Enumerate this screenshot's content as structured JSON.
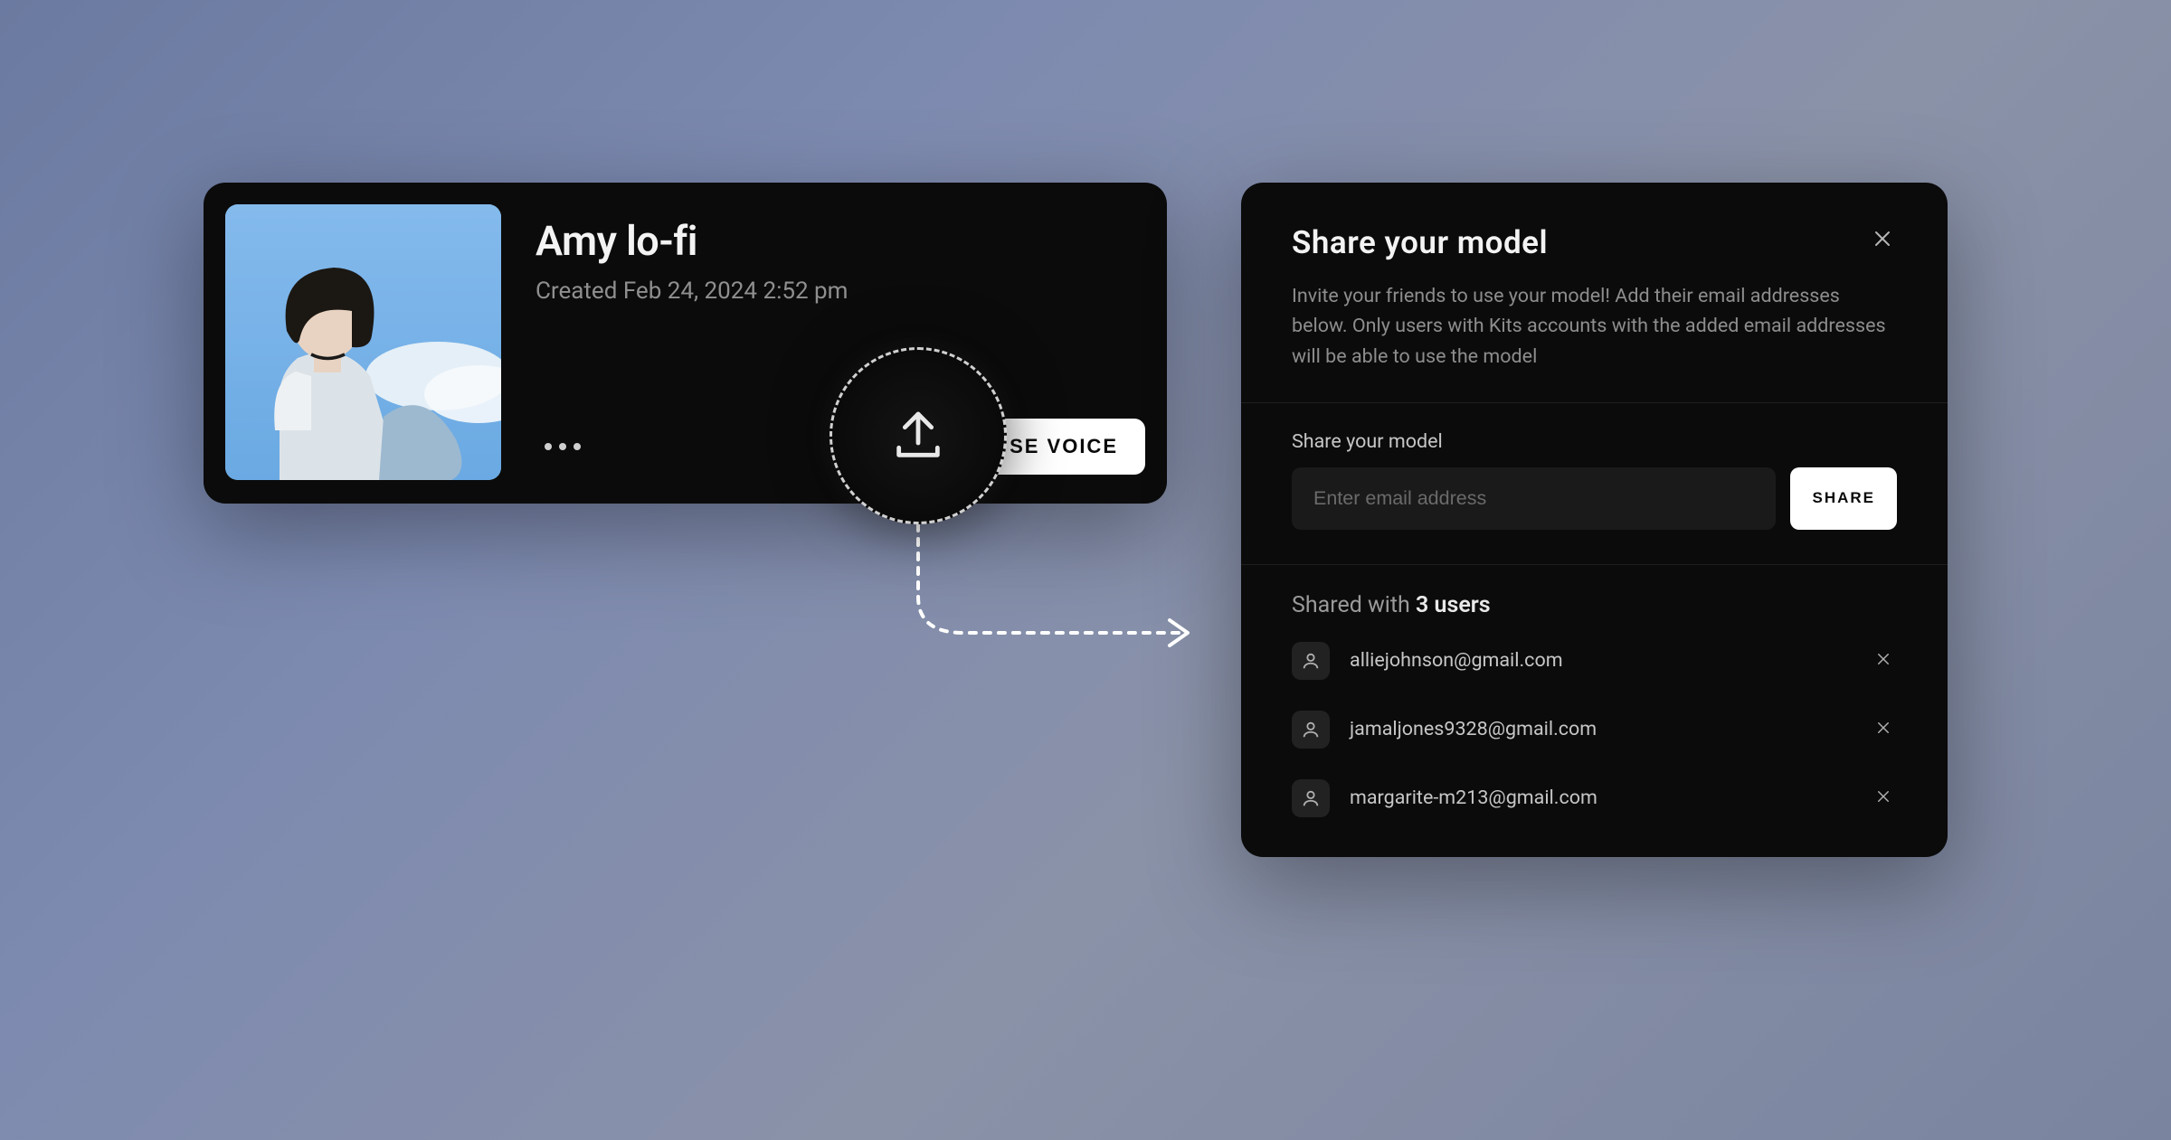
{
  "model_card": {
    "title": "Amy lo-fi",
    "created_label": "Created Feb 24, 2024 2:52 pm",
    "use_voice_label": "SE VOICE"
  },
  "share_panel": {
    "title": "Share your model",
    "description": "Invite your friends to use your model! Add their email addresses below. Only users with Kits accounts with the added email addresses will be able to use the model",
    "input_label": "Share your model",
    "placeholder": "Enter email address",
    "share_button_label": "SHARE",
    "shared_with_prefix": "Shared with ",
    "shared_count": "3",
    "shared_with_suffix": " users",
    "users": [
      {
        "email": "alliejohnson@gmail.com"
      },
      {
        "email": "jamaljones9328@gmail.com"
      },
      {
        "email": "margarite-m213@gmail.com"
      }
    ]
  }
}
